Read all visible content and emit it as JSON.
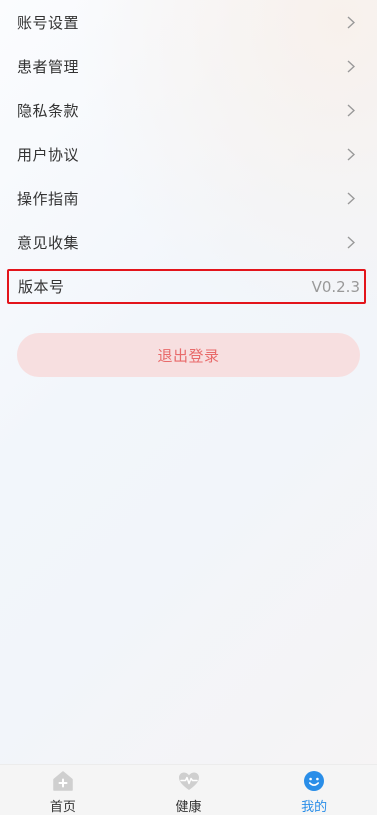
{
  "menu": {
    "items": [
      {
        "label": "账号设置",
        "icon": "chevron-right-icon"
      },
      {
        "label": "患者管理",
        "icon": "chevron-right-icon"
      },
      {
        "label": "隐私条款",
        "icon": "chevron-right-icon"
      },
      {
        "label": "用户协议",
        "icon": "chevron-right-icon"
      },
      {
        "label": "操作指南",
        "icon": "chevron-right-icon"
      },
      {
        "label": "意见收集",
        "icon": "chevron-right-icon"
      }
    ],
    "version": {
      "label": "版本号",
      "value": "V0.2.3"
    }
  },
  "logout_label": "退出登录",
  "tabbar": {
    "tabs": [
      {
        "label": "首页",
        "icon": "home-plus-icon",
        "active": false
      },
      {
        "label": "健康",
        "icon": "heart-pulse-icon",
        "active": false
      },
      {
        "label": "我的",
        "icon": "smiley-face-icon",
        "active": true
      }
    ]
  },
  "colors": {
    "accent": "#2a8ee8",
    "logout_bg": "#f7dfe0",
    "logout_text": "#e86a6a",
    "highlight_border": "#e3141b",
    "inactive_icon": "#cfcfcf"
  }
}
